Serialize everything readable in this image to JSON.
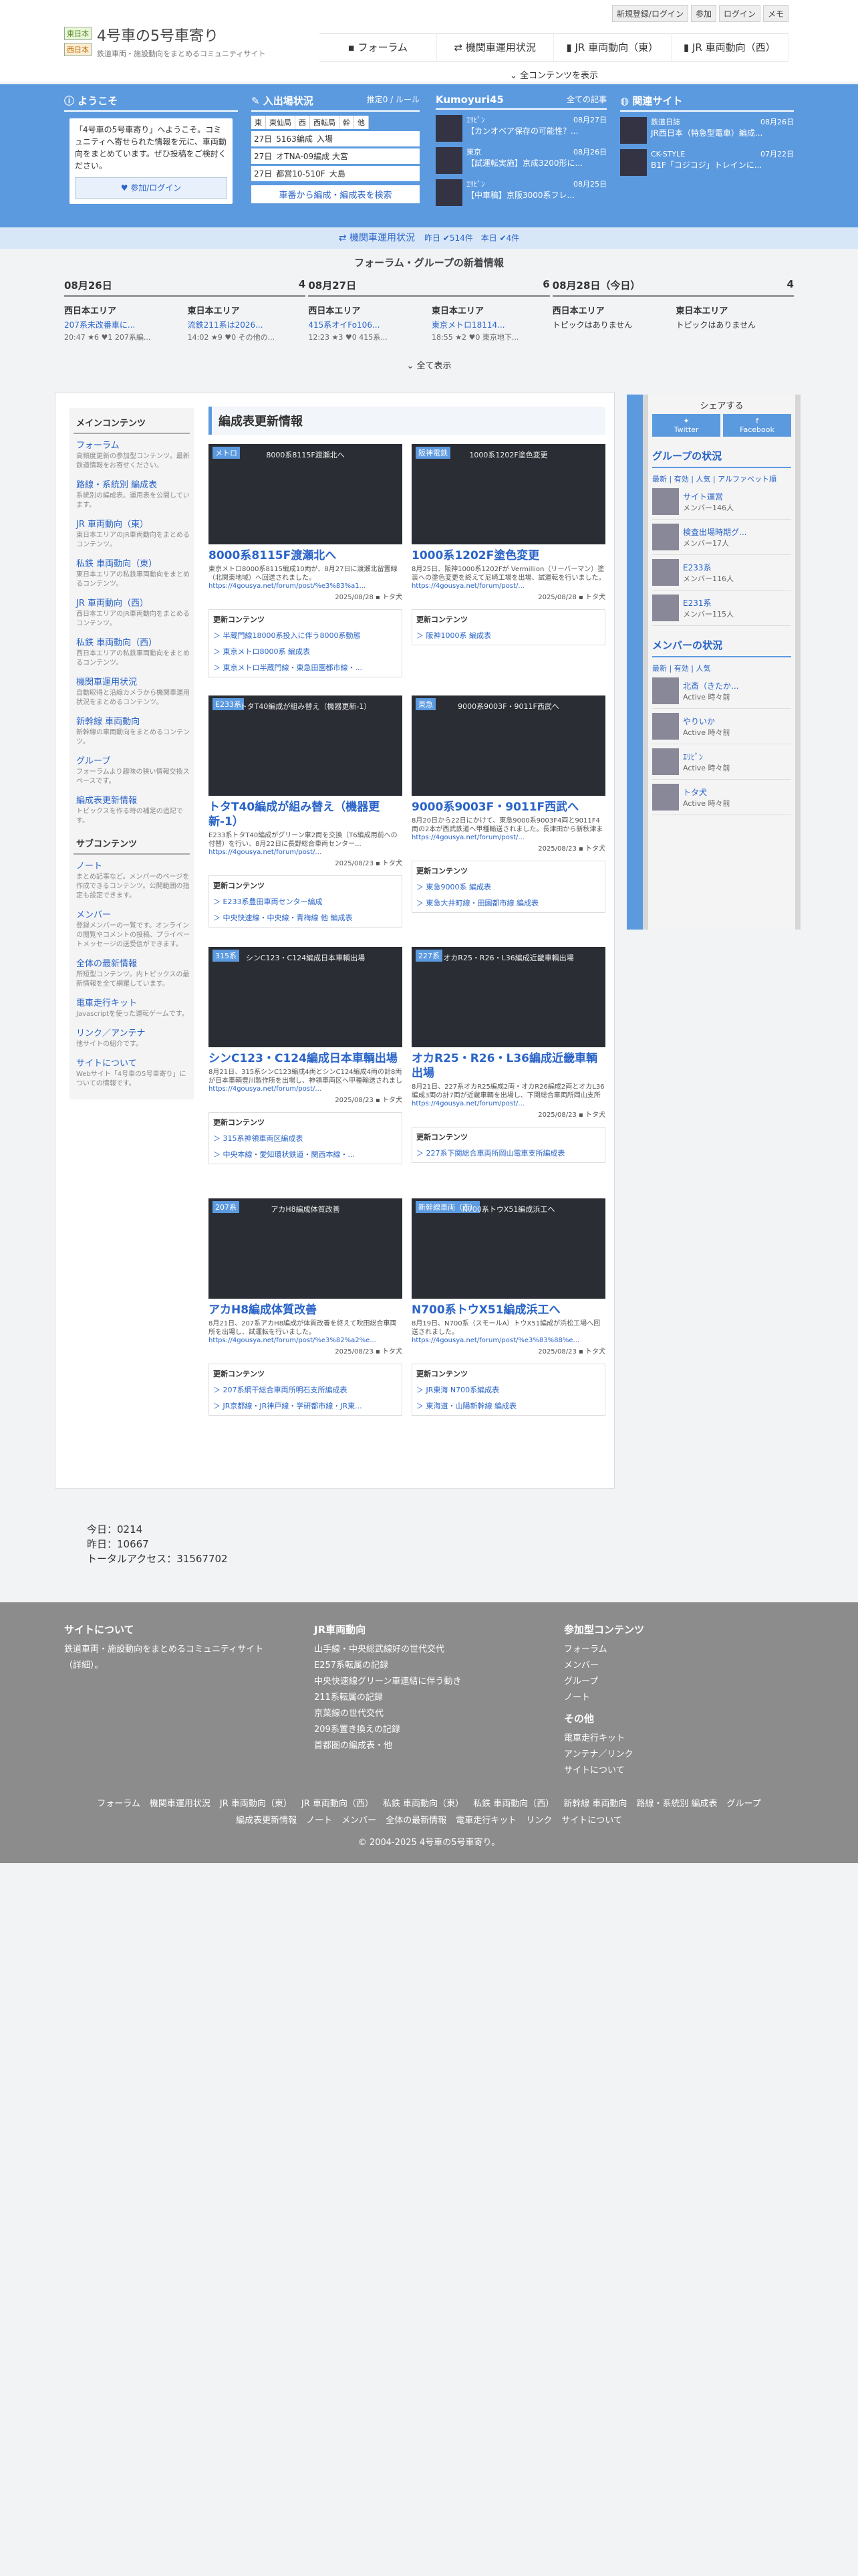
{
  "header": {
    "tag_east": "東日本",
    "tag_west": "西日本",
    "title": "4号車の5号車寄り",
    "subtitle": "鉄道車両・施設動向をまとめるコミュニティサイト",
    "topbar": [
      "新規登録/ログイン",
      "参加",
      "ログイン",
      "メモ"
    ],
    "nav": [
      "フォーラム",
      "機関車運用状況",
      "JR 車両動向（東）",
      "JR 車両動向（西）"
    ],
    "all_content": "全コンテンツを表示"
  },
  "welcome": {
    "title": "ようこそ",
    "text": "「4号車の5号車寄り」へようこそ。コミュニティへ寄せられた情報を元に、車両動向をまとめています。ぜひ投稿をご検討ください。",
    "login": "参加/ログイン"
  },
  "arrivals": {
    "title": "入出場状況",
    "link": "推定0 / ルール",
    "tabs": [
      "東",
      "東仙局",
      "西",
      "西転局",
      "幹",
      "他"
    ],
    "rows": [
      {
        "d": "27日",
        "t": "5163編成",
        "s": "入場"
      },
      {
        "d": "27日",
        "t": "オTNA-09編成 大宮",
        "s": ""
      },
      {
        "d": "27日",
        "t": "都営10-510F",
        "s": "大島"
      }
    ],
    "btn": "車番から編成・編成表を検索"
  },
  "kumo": {
    "title": "Kumoyuri45",
    "link": "全ての記事",
    "items": [
      {
        "src": "ｴﾘﾋﾟﾝ",
        "date": "08月27日",
        "text": "【カンオベア保存の可能性？..."
      },
      {
        "src": "東京",
        "date": "08月26日",
        "text": "【試運転実施】京成3200形に..."
      },
      {
        "src": "ｴﾘﾋﾟﾝ",
        "date": "08月25日",
        "text": "【中車稿】京阪3000系フレ..."
      }
    ]
  },
  "related": {
    "title": "関連サイト",
    "items": [
      {
        "src": "鉄道日誌",
        "date": "08月26日",
        "text": "JR西日本（特急型電車）編成..."
      },
      {
        "src": "CK-STYLE",
        "date": "07月22日",
        "text": "B1F「コジコジ」トレインに..."
      }
    ]
  },
  "opstatus": {
    "label": "機関車運用状況",
    "extra": "昨日 ✔514件　本日 ✔4件"
  },
  "forum": {
    "heading": "フォーラム・グループの新着情報",
    "days": [
      {
        "label": "08月26日",
        "count": "4",
        "cols": [
          {
            "area": "西日本エリア",
            "item": "207系未改番車に...",
            "meta": "20:47 ★6 ♥1 207系編..."
          },
          {
            "area": "東日本エリア",
            "item": "流鉄211系は2026...",
            "meta": "14:02 ★9 ♥0 その他の..."
          }
        ]
      },
      {
        "label": "08月27日",
        "count": "6",
        "cols": [
          {
            "area": "西日本エリア",
            "item": "415系オイFo106...",
            "meta": "12:23 ★3 ♥0 415系..."
          },
          {
            "area": "東日本エリア",
            "item": "東京メトロ18114...",
            "meta": "18:55 ★2 ♥0 東京地下..."
          }
        ]
      },
      {
        "label": "08月28日（今日）",
        "count": "4",
        "cols": [
          {
            "area": "西日本エリア",
            "item": "トピックはありません",
            "meta": ""
          },
          {
            "area": "東日本エリア",
            "item": "トピックはありません",
            "meta": ""
          }
        ]
      }
    ],
    "all": "全て表示"
  },
  "sidebar": {
    "main_title": "メインコンテンツ",
    "main": [
      {
        "t": "フォーラム",
        "d": "高頻度更新の参加型コンテンツ。最新鉄道情報をお寄せください。"
      },
      {
        "t": "路線・系統別 編成表",
        "d": "系統別の編成表。運用表を公開しています。"
      },
      {
        "t": "JR 車両動向（東）",
        "d": "東日本エリアのJR車両動向をまとめるコンテンツ。"
      },
      {
        "t": "私鉄 車両動向（東）",
        "d": "東日本エリアの私鉄車両動向をまとめるコンテンツ。"
      },
      {
        "t": "JR 車両動向（西）",
        "d": "西日本エリアのJR車両動向をまとめるコンテンツ。"
      },
      {
        "t": "私鉄 車両動向（西）",
        "d": "西日本エリアの私鉄車両動向をまとめるコンテンツ。"
      },
      {
        "t": "機関車運用状況",
        "d": "自動取得と沿線カメラから機関車運用状況をまとめるコンテンツ。"
      },
      {
        "t": "新幹線 車両動向",
        "d": "新幹線の車両動向をまとめるコンテンツ。"
      },
      {
        "t": "グループ",
        "d": "フォーラムより趣味の狭い情報交換スペースです。"
      },
      {
        "t": "編成表更新情報",
        "d": "トピックスを作る時の補足の追記です。"
      }
    ],
    "sub_title": "サブコンテンツ",
    "sub": [
      {
        "t": "ノート",
        "d": "まとめ記事など。メンバーのページを作成できるコンテンツ。公開範囲の指定も設定できます。"
      },
      {
        "t": "メンバー",
        "d": "登録メンバーの一覧です。オンラインの閲覧やコメントの投稿、プライベートメッセージの送受信ができます。"
      },
      {
        "t": "全体の最新情報",
        "d": "所短型コンテンツ。内トピックスの最新情報を全て網羅しています。"
      },
      {
        "t": "電車走行キット",
        "d": "Javascriptを使った運転ゲームです。"
      },
      {
        "t": "リンク／アンテナ",
        "d": "他サイトの紹介です。"
      },
      {
        "t": "サイトについて",
        "d": "Webサイト「4号車の5号車寄り」についての情報です。"
      }
    ]
  },
  "main": {
    "title": "編成表更新情報",
    "cards": [
      {
        "badge": "メトロ",
        "img": "8000系8115F渡瀬北へ",
        "title": "8000系8115F渡瀬北へ",
        "text": "東京メトロ8000系8115編成10両が、8月27日に渡瀬北留置線（北関東地域）へ回送されました。",
        "link": "https://4gousya.net/forum/post/%e3%83%a1...",
        "date": "2025/08/28",
        "user": "トタ犬",
        "upd": [
          "＞ 半蔵門線18000系投入に伴う8000系動態",
          "＞ 東京メトロ8000系 編成表",
          "＞ 東京メトロ半蔵門線・東急田園都市線・..."
        ]
      },
      {
        "badge": "阪神電鉄",
        "img": "1000系1202F塗色変更",
        "title": "1000系1202F塗色変更",
        "text": "8月25日、阪神1000系1202Fが Vermillion（リーバーマン）塗装への塗色変更を終えて尼崎工場を出場、試運転を行いました。",
        "link": "https://4gousya.net/forum/post/...",
        "date": "2025/08/28",
        "user": "トタ犬",
        "upd": [
          "＞ 阪神1000系 編成表"
        ]
      },
      {
        "badge": "E233系",
        "img": "トタT40編成が組み替え（機器更新-1）",
        "title": "トタT40編成が組み替え（機器更新-1）",
        "text": "E233系トタT40編成がグリーン車2両を交換（T6編成用前への付替）を行い、8月22日に長野総合車両センター...",
        "link": "https://4gousya.net/forum/post/...",
        "date": "2025/08/23",
        "user": "トタ犬",
        "upd": [
          "＞ E233系豊田車両センター編成",
          "＞ 中央快速線・中央線・青梅線 他 編成表"
        ]
      },
      {
        "badge": "東急",
        "img": "9000系9003F・9011F西武へ",
        "title": "9000系9003F・9011F西武へ",
        "text": "8月20日から22日にかけて、東急9000系9003F4両と9011F4両の2本が西武鉄道へ甲種輸送されました。長津田から新秋津まで輸送されました。",
        "link": "https://4gousya.net/forum/post/...",
        "date": "2025/08/23",
        "user": "トタ犬",
        "upd": [
          "＞ 東急9000系 編成表",
          "＞ 東急大井町線・田園都市線 編成表"
        ]
      },
      {
        "badge": "315系",
        "img": "シンC123・C124編成日本車輌出場",
        "title": "シンC123・C124編成日本車輌出場",
        "text": "8月21日、315系シンC123編成4両とシンC124編成4両の計8両が日本車輌豊川製作所を出場し、神領車両区へ甲種輸送されました。",
        "link": "https://4gousya.net/forum/post/...",
        "date": "2025/08/23",
        "user": "トタ犬",
        "upd": [
          "＞ 315系神領車両区編成表",
          "＞ 中央本線・愛知環状鉄道・関西本線・..."
        ]
      },
      {
        "badge": "227系",
        "img": "オカR25・R26・L36編成近畿車輌出場",
        "title": "オカR25・R26・L36編成近畿車輌出場",
        "text": "8月21日、227系オカR25編成2両・オカR26編成2両とオカL36編成3両の計7両が近畿車輌を出場し、下関総合車両所岡山支所へ。",
        "link": "https://4gousya.net/forum/post/...",
        "date": "2025/08/23",
        "user": "トタ犬",
        "upd": [
          "＞ 227系下関総合車両所岡山電車支所編成表"
        ]
      },
      {
        "badge": "207系",
        "img": "アカH8編成体質改善",
        "title": "アカH8編成体質改善",
        "text": "8月21日、207系アカH8編成が体質改善を終えて吹田総合車両所を出場し、試運転を行いました。",
        "link": "https://4gousya.net/forum/post/%e3%82%a2%e...",
        "date": "2025/08/23",
        "user": "トタ犬",
        "upd": [
          "＞ 207系網干総合車両所明石支所編成表",
          "＞ JR京都線・JR神戸線・学研都市線・JR東..."
        ]
      },
      {
        "badge": "新幹線車両（西）",
        "img": "N700系トウX51編成浜工へ",
        "title": "N700系トウX51編成浜工へ",
        "text": "8月19日、N700系（スモールA）トウX51編成が浜松工場へ回送されました。",
        "link": "https://4gousya.net/forum/post/%e3%83%88%e...",
        "date": "2025/08/23",
        "user": "トタ犬",
        "upd": [
          "＞ JR東海 N700系編成表",
          "＞ 東海道・山陽新幹線 編成表"
        ]
      }
    ]
  },
  "right": {
    "share": "シェアする",
    "twitter": "Twitter",
    "facebook": "Facebook",
    "group_title": "グループの状況",
    "tabs": "最新 | 有効 | 人気 | アルファベット順",
    "groups": [
      {
        "n": "サイト運営",
        "s": "メンバー146人"
      },
      {
        "n": "検査出場時期グ...",
        "s": "メンバー17人"
      },
      {
        "n": "E233系",
        "s": "メンバー116人"
      },
      {
        "n": "E231系",
        "s": "メンバー115人"
      }
    ],
    "member_title": "メンバーの状況",
    "mtabs": "最新 | 有効 | 人気",
    "members": [
      {
        "n": "北斎（きたか...",
        "s": "Active 時々前"
      },
      {
        "n": "やりいか",
        "s": "Active 時々前"
      },
      {
        "n": "ｴﾘﾋﾟﾝ",
        "s": "Active 時々前"
      },
      {
        "n": "トタ犬",
        "s": "Active 時々前"
      }
    ]
  },
  "counts": {
    "today": "今日：0214",
    "yesterday": "昨日：10667",
    "total": "トータルアクセス：31567702"
  },
  "footer": {
    "c1h": "サイトについて",
    "c1": [
      "鉄道車両・施設動向をまとめるコミュニティサイト（詳細）。"
    ],
    "c2h": "JR車両動向",
    "c2": [
      "山手線・中央総武線好の世代交代",
      "E257系転属の記録",
      "中央快速線グリーン車連結に伴う動き",
      "211系転属の記録",
      "京葉線の世代交代",
      "209系置き換えの記録",
      "首都圏の編成表・他"
    ],
    "c3h": "参加型コンテンツ",
    "c3": [
      "フォーラム",
      "メンバー",
      "グループ",
      "ノート"
    ],
    "c4h": "その他",
    "c4": [
      "電車走行キット",
      "アンテナ／リンク",
      "サイトについて"
    ],
    "bar": [
      "フォーラム",
      "機関車運用状況",
      "JR 車両動向（東）",
      "JR 車両動向（西）",
      "私鉄 車両動向（東）",
      "私鉄 車両動向（西）",
      "新幹線 車両動向",
      "路線・系統別 編成表",
      "グループ",
      "編成表更新情報",
      "ノート",
      "メンバー",
      "全体の最新情報",
      "電車走行キット",
      "リンク",
      "サイトについて"
    ],
    "copy": "© 2004-2025 4号車の5号車寄り。"
  }
}
